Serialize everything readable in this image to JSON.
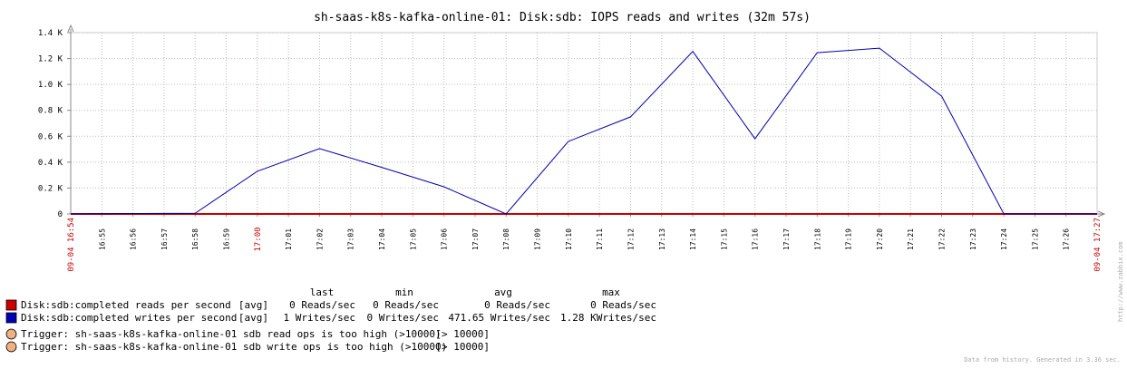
{
  "chart_data": {
    "type": "line",
    "title": "sh-saas-k8s-kafka-online-01: Disk:sdb: IOPS reads and writes (32m 57s)",
    "xlabel": "",
    "ylabel": "",
    "ylim": [
      0,
      1400
    ],
    "y_ticks": [
      {
        "value": 0,
        "label": "0"
      },
      {
        "value": 200,
        "label": "0.2 K"
      },
      {
        "value": 400,
        "label": "0.4 K"
      },
      {
        "value": 600,
        "label": "0.6 K"
      },
      {
        "value": 800,
        "label": "0.8 K"
      },
      {
        "value": 1000,
        "label": "1.0 K"
      },
      {
        "value": 1200,
        "label": "1.2 K"
      },
      {
        "value": 1400,
        "label": "1.4 K"
      }
    ],
    "x_start_label": "09-04 16:54",
    "x_end_label": "09-04 17:27",
    "x_tick_labels": [
      "16:55",
      "16:56",
      "16:57",
      "16:58",
      "16:59",
      "17:00",
      "17:01",
      "17:02",
      "17:03",
      "17:04",
      "17:05",
      "17:06",
      "17:07",
      "17:08",
      "17:09",
      "17:10",
      "17:11",
      "17:12",
      "17:13",
      "17:14",
      "17:15",
      "17:16",
      "17:17",
      "17:18",
      "17:19",
      "17:20",
      "17:21",
      "17:22",
      "17:23",
      "17:24",
      "17:25",
      "17:26"
    ],
    "x_tick_highlight": [
      "17:00"
    ],
    "x_start_minute": "16:54",
    "series": [
      {
        "name": "Disk:sdb:completed reads per second",
        "color": "#cc0000",
        "x": [
          "16:54",
          "16:58",
          "17:00",
          "17:02",
          "17:04",
          "17:06",
          "17:08",
          "17:10",
          "17:12",
          "17:14",
          "17:16",
          "17:18",
          "17:20",
          "17:22",
          "17:24",
          "17:27"
        ],
        "values": [
          0,
          0,
          0,
          0,
          0,
          0,
          0,
          0,
          0,
          0,
          0,
          0,
          0,
          0,
          0,
          0
        ]
      },
      {
        "name": "Disk:sdb:completed writes per second",
        "color": "#0000b4",
        "x": [
          "16:54",
          "16:58",
          "17:00",
          "17:02",
          "17:04",
          "17:06",
          "17:08",
          "17:10",
          "17:12",
          "17:14",
          "17:16",
          "17:18",
          "17:20",
          "17:22",
          "17:24",
          "17:27"
        ],
        "values": [
          1,
          5,
          330,
          505,
          360,
          210,
          0,
          560,
          750,
          1255,
          580,
          1245,
          1280,
          910,
          1,
          1
        ]
      }
    ]
  },
  "legend": {
    "headers": {
      "last": "last",
      "min": "min",
      "avg": "avg",
      "max": "max"
    },
    "rows": [
      {
        "name": "Disk:sdb:completed reads per second",
        "func": "[avg]",
        "last": "0 Reads/sec",
        "min": "0 Reads/sec",
        "avg": "0 Reads/sec",
        "max": "0 Reads/sec",
        "color": "#cc0000"
      },
      {
        "name": "Disk:sdb:completed writes per second",
        "func": "[avg]",
        "last": "1 Writes/sec",
        "min": "0 Writes/sec",
        "avg": "471.65 Writes/sec",
        "max": "1.28 KWrites/sec",
        "color": "#0000b4"
      }
    ],
    "triggers": [
      {
        "text": "Trigger: sh-saas-k8s-kafka-online-01 sdb read ops is too high (>10000)",
        "threshold": "[> 10000]",
        "color": "#f0b080"
      },
      {
        "text": "Trigger: sh-saas-k8s-kafka-online-01 sdb write ops is too high (>10000)",
        "threshold": "[> 10000]",
        "color": "#f0b080"
      }
    ]
  },
  "footer": {
    "source": "Data from history. Generated in 3.36 sec.",
    "zabbix": "http://www.zabbix.com"
  }
}
